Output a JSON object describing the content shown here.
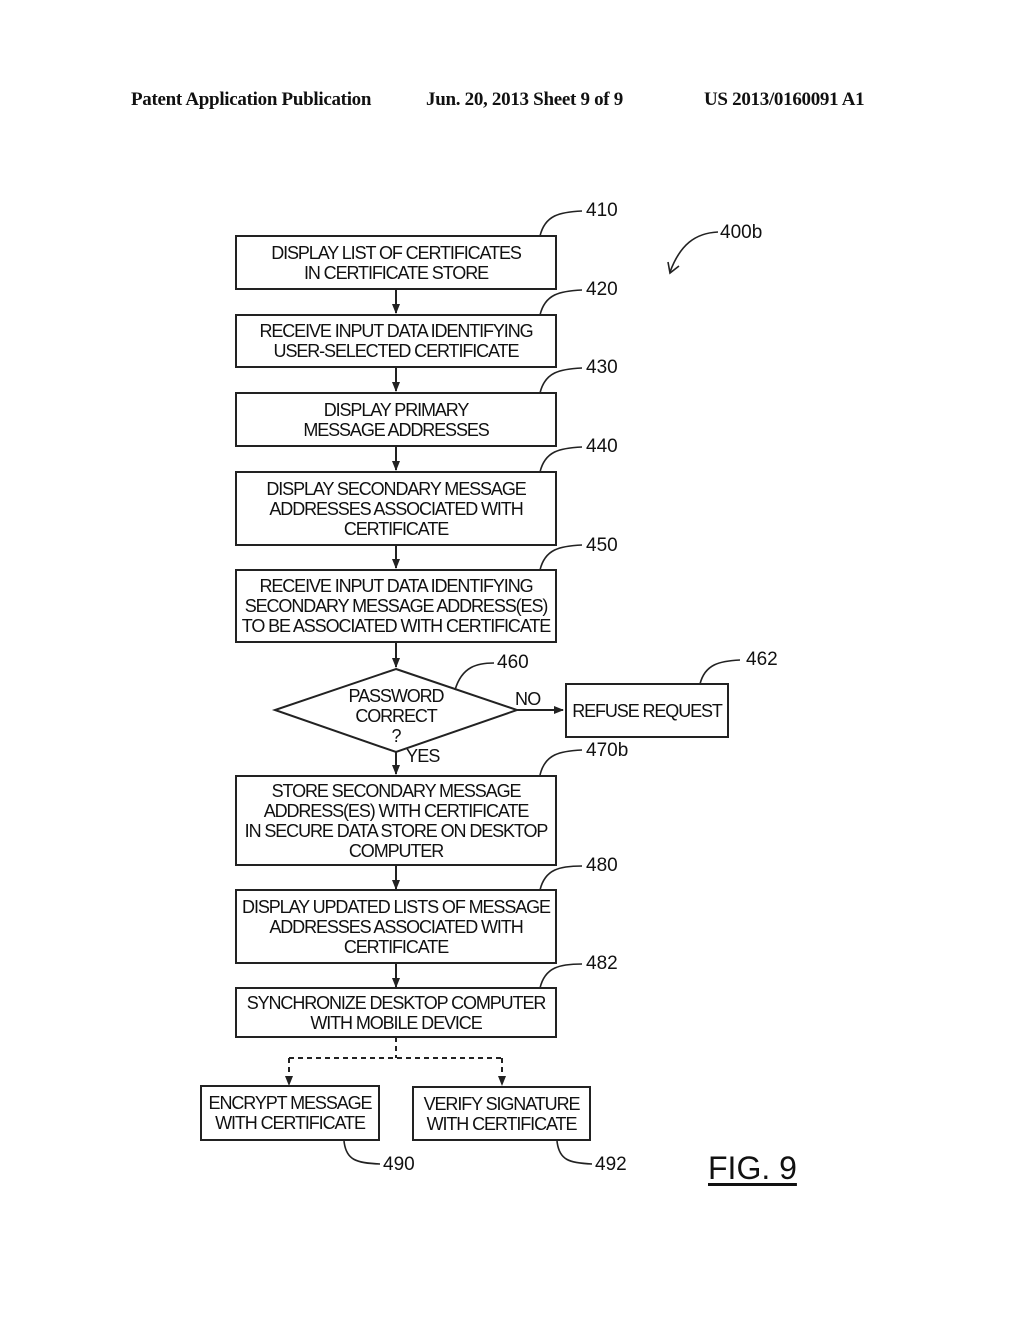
{
  "header": {
    "publication": "Patent Application Publication",
    "date_sheet": "Jun. 20, 2013  Sheet 9 of 9",
    "patent_number": "US 2013/0160091 A1"
  },
  "figure": {
    "label": "FIG. 9",
    "ref": "400b",
    "steps": [
      {
        "ref": "410",
        "text": "DISPLAY LIST OF CERTIFICATES\nIN CERTIFICATE STORE"
      },
      {
        "ref": "420",
        "text": "RECEIVE INPUT DATA IDENTIFYING\nUSER-SELECTED CERTIFICATE"
      },
      {
        "ref": "430",
        "text": "DISPLAY PRIMARY\nMESSAGE ADDRESSES"
      },
      {
        "ref": "440",
        "text": "DISPLAY SECONDARY MESSAGE\nADDRESSES ASSOCIATED WITH\nCERTIFICATE"
      },
      {
        "ref": "450",
        "text": "RECEIVE INPUT DATA IDENTIFYING\nSECONDARY MESSAGE ADDRESS(ES)\nTO BE ASSOCIATED WITH CERTIFICATE"
      },
      {
        "ref": "470b",
        "text": "STORE SECONDARY MESSAGE\nADDRESS(ES) WITH CERTIFICATE\nIN SECURE DATA STORE ON DESKTOP\nCOMPUTER"
      },
      {
        "ref": "480",
        "text": "DISPLAY UPDATED LISTS OF MESSAGE\nADDRESSES ASSOCIATED WITH\nCERTIFICATE"
      },
      {
        "ref": "482",
        "text": "SYNCHRONIZE DESKTOP COMPUTER\nWITH MOBILE DEVICE"
      }
    ],
    "decision": {
      "ref": "460",
      "text": "PASSWORD\nCORRECT\n?",
      "yes_label": "YES",
      "no_label": "NO"
    },
    "refuse": {
      "ref": "462",
      "text": "REFUSE REQUEST"
    },
    "optional": [
      {
        "ref": "490",
        "text": "ENCRYPT MESSAGE\nWITH CERTIFICATE"
      },
      {
        "ref": "492",
        "text": "VERIFY SIGNATURE\nWITH CERTIFICATE"
      }
    ]
  }
}
